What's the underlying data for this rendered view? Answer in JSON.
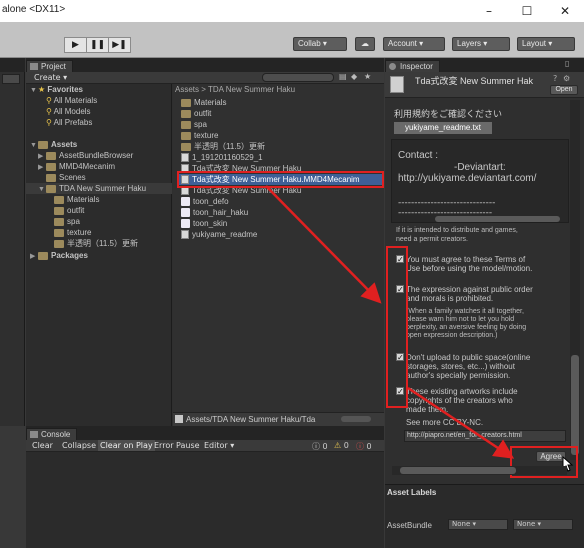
{
  "window": {
    "title": "alone <DX11>",
    "minimize": "–",
    "maximize": "☐",
    "close": "✕"
  },
  "toolbar": {
    "play": "▶",
    "pause": "❚❚",
    "step": "▶❚",
    "collab": "Collab ▾",
    "cloud": "☁",
    "account": "Account ▾",
    "layers": "Layers ▾",
    "layout": "Layout ▾"
  },
  "project": {
    "tab": "Project",
    "create": "Create ▾",
    "search_placeholder": "",
    "favorites_label": "Favorites",
    "favorites": [
      "All Materials",
      "All Models",
      "All Prefabs"
    ],
    "assets_label": "Assets",
    "asset_tree": [
      "AssetBundleBrowser",
      "MMD4Mecanim",
      "Scenes",
      "TDA New Summer Haku"
    ],
    "haku_children": [
      "Materials",
      "outfit",
      "spa",
      "texture",
      "半透明（11.5）更新"
    ],
    "packages_label": "Packages",
    "breadcrumb": "Assets > TDA New Summer Haku",
    "files": [
      {
        "name": "Materials",
        "kind": "folder"
      },
      {
        "name": "outfit",
        "kind": "folder"
      },
      {
        "name": "spa",
        "kind": "folder"
      },
      {
        "name": "texture",
        "kind": "folder"
      },
      {
        "name": "半透明（11.5）更新",
        "kind": "folder"
      },
      {
        "name": "1_191201160529_1",
        "kind": "doc"
      },
      {
        "name": "Tda式改変 New Summer Haku",
        "kind": "doc"
      },
      {
        "name": "Tda式改変 New Summer Haku.MMD4Mecanim",
        "kind": "doc"
      },
      {
        "name": "Tda式改変 New Summer Haku",
        "kind": "doc"
      },
      {
        "name": "toon_defo",
        "kind": "mtl"
      },
      {
        "name": "toon_hair_haku",
        "kind": "mtl"
      },
      {
        "name": "toon_skin",
        "kind": "mtl"
      },
      {
        "name": "yukiyame_readme",
        "kind": "doc"
      }
    ],
    "footer_path": "Assets/TDA New Summer Haku/Tda"
  },
  "console": {
    "tab": "Console",
    "buttons": [
      "Clear",
      "Collapse",
      "Clear on Play",
      "Error Pause",
      "Editor ▾"
    ],
    "counts": [
      "0",
      "0",
      "0"
    ]
  },
  "inspector": {
    "tab": "Inspector",
    "object_title": "Tda式改変 New Summer Hak",
    "open_button": "Open",
    "terms_label": "利用規約をご確認ください",
    "readme_file": "yukiyame_readme.txt",
    "contact_heading": "Contact :",
    "contact_deviantart": "-Deviantart:",
    "contact_url": "http://yukiyame.deviantart.com/",
    "dashes_1": "------------------------------",
    "dashes_2": "-----------------------------",
    "permit_note_1": "If it is intended to distribute and games,",
    "permit_note_2": "need a permit creators.",
    "terms": [
      {
        "lines": [
          "You must agree to these Terms of",
          "Use before using the model/motion."
        ],
        "sub": []
      },
      {
        "lines": [
          "The expression against public order",
          "and morals is prohibited."
        ],
        "sub": [
          "(When a family watches it all together,",
          "please warn him not to let you hold",
          "perplexity, an aversive feeling by doing",
          "open expression description.)"
        ]
      },
      {
        "lines": [
          "Don't upload to public space(online",
          "storages, stores, etc...) without",
          "author's specially permission."
        ],
        "sub": []
      },
      {
        "lines": [
          "These existing artworks include",
          "copyrights of the creators who",
          "made them."
        ],
        "sub": []
      }
    ],
    "see_more": "See more CC BY-NC.",
    "creators_url": "http://piapro.net/en_for_creators.html",
    "agree_button": "Agree",
    "asset_labels": "Asset Labels",
    "asset_bundle_label": "AssetBundle",
    "asset_bundle_value": "None ▾",
    "asset_bundle_value2": "None ▾"
  },
  "colors": {
    "highlight": "#e02020",
    "selection": "#3e5f96"
  }
}
